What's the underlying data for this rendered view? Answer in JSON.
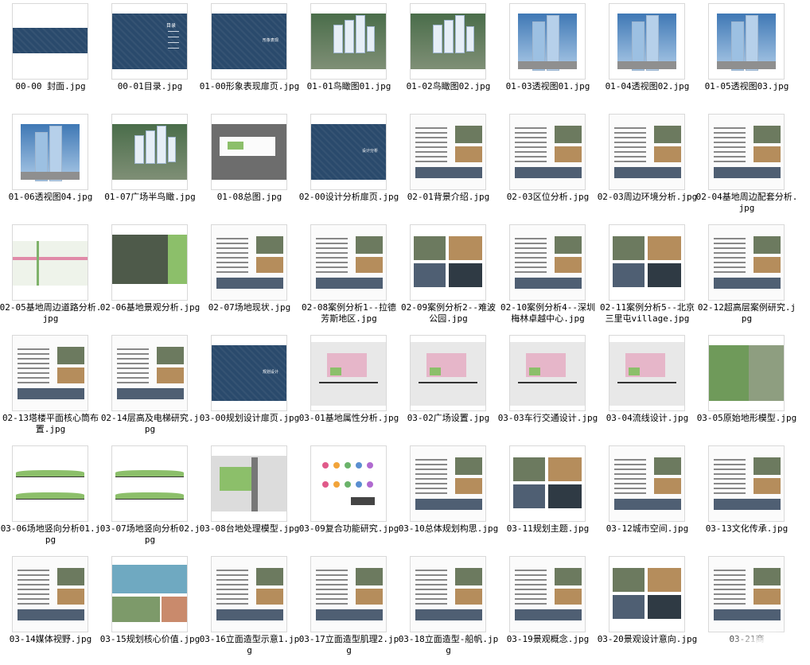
{
  "files": [
    {
      "name": "00-00 封面.jpg",
      "kind": "cover"
    },
    {
      "name": "00-01目录.jpg",
      "kind": "toc"
    },
    {
      "name": "01-00形象表现扉页.jpg",
      "kind": "divider"
    },
    {
      "name": "01-01鸟瞰图01.jpg",
      "kind": "aerial"
    },
    {
      "name": "01-02鸟瞰图02.jpg",
      "kind": "aerial"
    },
    {
      "name": "01-03透视图01.jpg",
      "kind": "tower"
    },
    {
      "name": "01-04透视图02.jpg",
      "kind": "tower"
    },
    {
      "name": "01-05透视图03.jpg",
      "kind": "tower"
    },
    {
      "name": "01-06透视图04.jpg",
      "kind": "tower"
    },
    {
      "name": "01-07广场半鸟瞰.jpg",
      "kind": "aerial"
    },
    {
      "name": "01-08总图.jpg",
      "kind": "plan"
    },
    {
      "name": "02-00设计分析扉页.jpg",
      "kind": "divider"
    },
    {
      "name": "02-01背景介绍.jpg",
      "kind": "page"
    },
    {
      "name": "02-03区位分析.jpg",
      "kind": "page"
    },
    {
      "name": "02-03周边环境分析.jpg",
      "kind": "page"
    },
    {
      "name": "02-04基地周边配套分析.jpg",
      "kind": "page"
    },
    {
      "name": "02-05基地周边道路分析.jpg",
      "kind": "map"
    },
    {
      "name": "02-06基地景观分析.jpg",
      "kind": "satellite"
    },
    {
      "name": "02-07场地现状.jpg",
      "kind": "page"
    },
    {
      "name": "02-08案例分析1--拉德芳斯地区.jpg",
      "kind": "page"
    },
    {
      "name": "02-09案例分析2--难波公园.jpg",
      "kind": "photos"
    },
    {
      "name": "02-10案例分析4--深圳梅林卓越中心.jpg",
      "kind": "page"
    },
    {
      "name": "02-11案例分析5--北京三里屯village.jpg",
      "kind": "photos"
    },
    {
      "name": "02-12超高层案例研究.jpg",
      "kind": "page"
    },
    {
      "name": "02-13塔楼平面核心筒布置.jpg",
      "kind": "page"
    },
    {
      "name": "02-14层高及电梯研究.jpg",
      "kind": "page"
    },
    {
      "name": "03-00规划设计扉页.jpg",
      "kind": "divider"
    },
    {
      "name": "03-01基地属性分析.jpg",
      "kind": "plan2"
    },
    {
      "name": "03-02广场设置.jpg",
      "kind": "plan2"
    },
    {
      "name": "03-03车行交通设计.jpg",
      "kind": "plan2"
    },
    {
      "name": "03-04流线设计.jpg",
      "kind": "plan2"
    },
    {
      "name": "03-05原始地形模型.jpg",
      "kind": "terrain"
    },
    {
      "name": "03-06场地竖向分析01.jpg",
      "kind": "section"
    },
    {
      "name": "03-07场地竖向分析02.jpg",
      "kind": "section"
    },
    {
      "name": "03-08台地处理模型.jpg",
      "kind": "model"
    },
    {
      "name": "03-09复合功能研究.jpg",
      "kind": "diagram"
    },
    {
      "name": "03-10总体规划构思.jpg",
      "kind": "page"
    },
    {
      "name": "03-11规划主题.jpg",
      "kind": "photos"
    },
    {
      "name": "03-12城市空间.jpg",
      "kind": "page"
    },
    {
      "name": "03-13文化传承.jpg",
      "kind": "page"
    },
    {
      "name": "03-14媒体视野.jpg",
      "kind": "page"
    },
    {
      "name": "03-15规划核心价值.jpg",
      "kind": "landscape"
    },
    {
      "name": "03-16立面造型示意1.jpg",
      "kind": "page"
    },
    {
      "name": "03-17立面造型肌理2.jpg",
      "kind": "page"
    },
    {
      "name": "03-18立面造型-船帆.jpg",
      "kind": "page"
    },
    {
      "name": "03-19景观概念.jpg",
      "kind": "page"
    },
    {
      "name": "03-20景观设计意向.jpg",
      "kind": "photos"
    },
    {
      "name": "03-21商",
      "kind": "page"
    }
  ],
  "divider_labels": [
    "形象表现",
    "设计分析",
    "规划设计"
  ],
  "toc_label": "目录",
  "colors": {
    "cover": "#2a4a6c",
    "border": "#d9d9d9",
    "text": "#000000"
  }
}
